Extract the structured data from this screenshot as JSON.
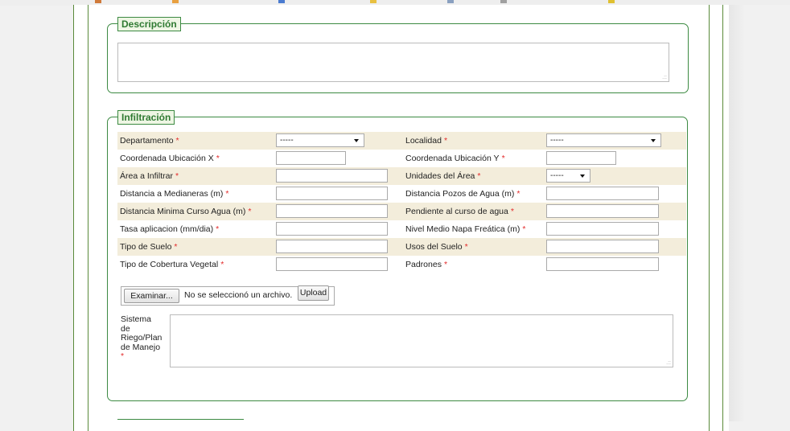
{
  "descripcion": {
    "legend": "Descripción",
    "value": ""
  },
  "infiltracion": {
    "legend": "Infiltración",
    "rows": [
      {
        "left_label": "Departamento",
        "left_value": "-----",
        "right_label": "Localidad",
        "right_value": "-----"
      },
      {
        "left_label": "Coordenada Ubicación X",
        "left_value": "",
        "right_label": "Coordenada Ubicación Y",
        "right_value": ""
      },
      {
        "left_label": "Área a Infiltrar",
        "left_value": "",
        "right_label": "Unidades del Área",
        "right_value": "-----"
      },
      {
        "left_label": "Distancia a Medianeras (m)",
        "left_value": "",
        "right_label": "Distancia Pozos de Agua (m)",
        "right_value": ""
      },
      {
        "left_label": "Distancia Minima Curso Agua (m)",
        "left_value": "",
        "right_label": "Pendiente al curso de agua",
        "right_value": ""
      },
      {
        "left_label": "Tasa aplicacion (mm/dia)",
        "left_value": "",
        "right_label": "Nivel Medio Napa Freática (m)",
        "right_value": ""
      },
      {
        "left_label": "Tipo de Suelo",
        "left_value": "",
        "right_label": "Usos del Suelo",
        "right_value": ""
      },
      {
        "left_label": "Tipo de Cobertura Vegetal",
        "left_value": "",
        "right_label": "Padrones",
        "right_value": ""
      }
    ],
    "required_mark": "*",
    "file": {
      "browse_label": "Examinar...",
      "status": "No se seleccionó un archivo.",
      "upload_label": "Upload"
    },
    "sistema": {
      "label_lines": [
        "Sistema",
        "de",
        "Riego/Plan",
        "de Manejo"
      ],
      "value": ""
    }
  },
  "colors": {
    "border_green": "#3c8a42",
    "legend_bg": "#eef6e4",
    "row_shade": "#f3eddb",
    "required": "#e32b2b"
  }
}
